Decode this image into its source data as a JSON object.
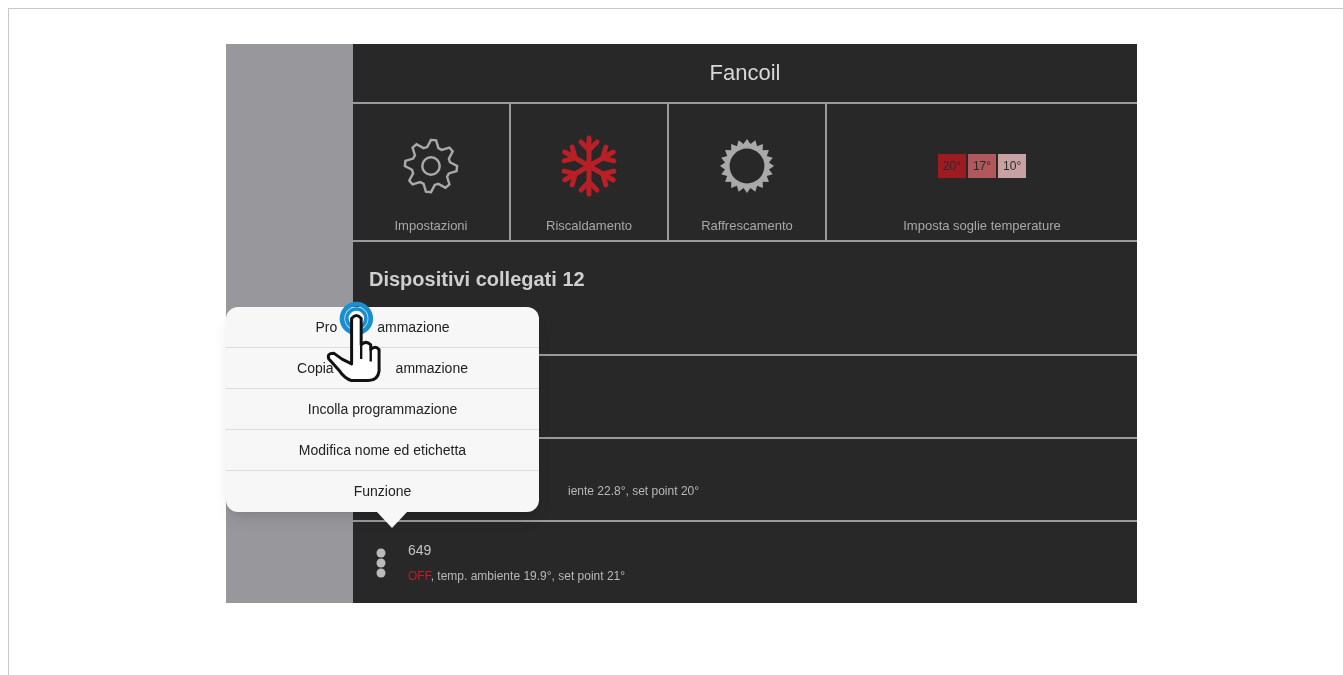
{
  "header": {
    "title": "Fancoil"
  },
  "tiles": [
    {
      "kind": "gear",
      "label": "Impostazioni",
      "active": false
    },
    {
      "kind": "snowflake",
      "label": "Riscaldamento",
      "active": true
    },
    {
      "kind": "sun",
      "label": "Raffrescamento",
      "active": false
    },
    {
      "kind": "thresholds",
      "label": "Imposta soglie temperature",
      "thresholds": [
        {
          "text": "20°",
          "color": "#9e1b22"
        },
        {
          "text": "17°",
          "color": "#b0585c"
        },
        {
          "text": "10°",
          "color": "#c8a2a2"
        }
      ]
    }
  ],
  "devices": {
    "heading": "Dispositivi collegati 12",
    "rows": [
      {
        "detail": "iente 22.8°, set point 20°"
      },
      {
        "name": "649",
        "state": "OFF",
        "on": false,
        "detail": ", temp. ambiente 19.9°, set point 21°"
      }
    ]
  },
  "context_menu": {
    "items": [
      {
        "parts": [
          "Pro",
          "ammazione"
        ]
      },
      {
        "parts": [
          "Copia",
          "ammazione"
        ]
      },
      {
        "parts": [
          "Incolla programmazione"
        ]
      },
      {
        "parts": [
          "Modifica nome ed etichetta"
        ]
      },
      {
        "parts": [
          "Funzione"
        ]
      }
    ]
  }
}
